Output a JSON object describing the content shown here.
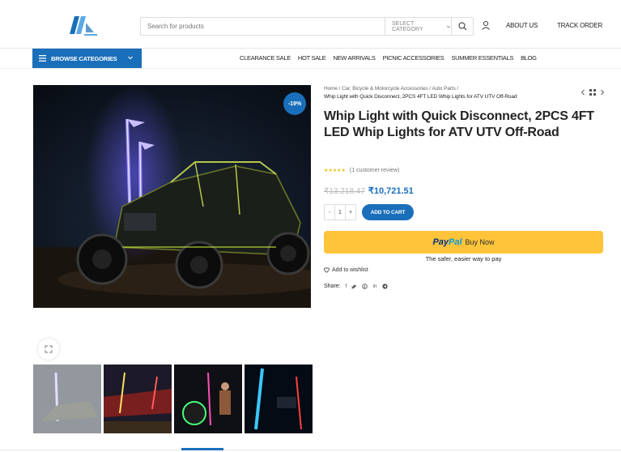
{
  "header": {
    "search_placeholder": "Search for products",
    "category_select": "SELECT CATEGORY",
    "links": [
      "ABOUT US",
      "TRACK ORDER"
    ]
  },
  "nav": {
    "browse_label": "BROWSE CATEGORIES",
    "menu": [
      "CLEARANCE SALE",
      "HOT SALE",
      "NEW ARRIVALS",
      "PICNIC ACCESSORIES",
      "SUMMER ESSENTIALS",
      "BLOG"
    ]
  },
  "product": {
    "sale_badge": "-19%",
    "breadcrumb": [
      "Home",
      "Car, Bicycle & Motorcycle Accessories",
      "Auto Parts"
    ],
    "breadcrumb_current": "Whip Light with Quick Disconnect, 2PCS 4FT LED Whip Lights for ATV UTV Off-Road",
    "title": "Whip Light with Quick Disconnect, 2PCS 4FT LED Whip Lights for ATV UTV Off-Road",
    "rating_stars": 5,
    "review_text": "(1 customer review)",
    "old_price": "₹13,218.47",
    "new_price": "₹10,721.51",
    "quantity": "1",
    "add_to_cart": "ADD TO CART",
    "paypal_pay": "Pay",
    "paypal_pal": "Pal",
    "paypal_buy": "Buy Now",
    "paypal_tagline": "The safer, easier way to pay",
    "wishlist": "Add to wishlist",
    "share_label": "Share:"
  },
  "colors": {
    "accent": "#1a6fba",
    "paypal_yellow": "#ffc439",
    "star": "#eabe12"
  }
}
